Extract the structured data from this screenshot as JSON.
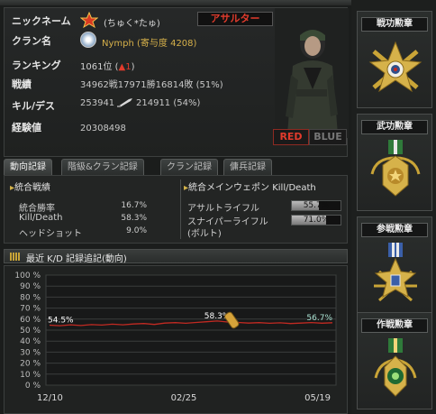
{
  "profile": {
    "labels": {
      "nickname": "ニックネーム",
      "clan": "クラン名",
      "ranking": "ランキング",
      "record": "戦績",
      "kill_death": "キル/デス",
      "experience": "経験値"
    },
    "nickname": "(ちゅく*たゅ)",
    "class_badge": "アサルター",
    "clan": "Nymph (寄与度 4208)",
    "ranking": "1061位 (",
    "ranking_change": "▲1",
    "ranking_close": ")",
    "record": "34962戦17971勝16814敗 (51%)",
    "kills": "253941",
    "deaths": "214911 (54%)",
    "experience": "20308498",
    "team_red": "RED",
    "team_blue": "BLUE"
  },
  "tabs": [
    {
      "label": "動向記録",
      "active": true
    },
    {
      "label": "階級&クラン記録",
      "active": false
    },
    {
      "label": "クラン記録",
      "active": false
    },
    {
      "label": "傭兵記録",
      "active": false
    }
  ],
  "stats": {
    "overall_title": "統合戦績",
    "overall": [
      {
        "label": "統合勝率",
        "value": "16.7%"
      },
      {
        "label": "Kill/Death",
        "value": "58.3%"
      },
      {
        "label": "ヘッドショット",
        "value": "9.0%"
      }
    ],
    "weapon_title": "統合メインウェポン Kill/Death",
    "weapons": [
      {
        "label": "アサルトライフル",
        "value": "55.7%",
        "fill": 0.557
      },
      {
        "label": "スナイパーライフル\n(ボルト)",
        "label_line1": "スナイパーライフル",
        "label_line2": "(ボルト)",
        "value": "71.0%",
        "fill": 0.71
      }
    ]
  },
  "chart_header": "最近 K/D 記録追記(動向)",
  "chart_data": {
    "type": "line",
    "title": "最近 K/D 記録追記(動向)",
    "xlabel": "",
    "ylabel": "",
    "ylim": [
      0,
      100
    ],
    "y_ticks": [
      "100 %",
      "90 %",
      "80 %",
      "70 %",
      "60 %",
      "50 %",
      "40 %",
      "30 %",
      "20 %",
      "10 %",
      "0 %"
    ],
    "x_ticks": [
      "12/10",
      "02/25",
      "05/19"
    ],
    "series": [
      {
        "values": [
          54.5,
          54.0,
          54.8,
          54.2,
          55.0,
          54.6,
          55.4,
          54.8,
          55.6,
          56.0,
          55.2,
          56.4,
          56.8,
          56.2,
          57.0,
          57.6,
          58.3,
          57.4,
          57.0,
          56.4,
          56.8,
          56.2,
          56.6,
          56.0,
          56.4,
          56.9,
          56.3,
          56.7
        ],
        "color": "#c22a22"
      }
    ],
    "annotations": [
      {
        "label": "54.5%",
        "x_index": 0
      },
      {
        "label": "58.3%",
        "x_index": 16
      },
      {
        "label": "56.7%",
        "x_index": 27
      }
    ],
    "grid": true
  },
  "medals": [
    {
      "title": "戦功勲章",
      "color": "#c9a437"
    },
    {
      "title": "武功勲章",
      "color": "#c9a437"
    },
    {
      "title": "参戦勲章",
      "color": "#c9a437"
    },
    {
      "title": "作戦勲章",
      "color": "#c9a437"
    }
  ]
}
